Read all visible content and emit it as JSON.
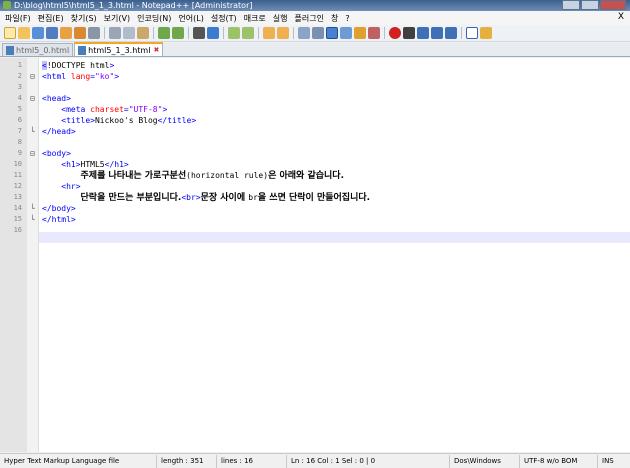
{
  "window": {
    "title": "D:\\blog\\html5\\html5_1_3.html - Notepad++ [Administrator]"
  },
  "menu": [
    "파일(F)",
    "편집(E)",
    "찾기(S)",
    "보기(V)",
    "인코딩(N)",
    "언어(L)",
    "설정(T)",
    "매크로",
    "실행",
    "플러그인",
    "창",
    "?"
  ],
  "menu_close": "X",
  "tabs": [
    {
      "label": "html5_0.html"
    },
    {
      "label": "html5_1_3.html"
    }
  ],
  "lines": [
    {
      "n": "1",
      "parts": [
        [
          "tag",
          "<"
        ],
        [
          "txt",
          "!DOCTYPE html"
        ],
        [
          "tag",
          ">"
        ]
      ]
    },
    {
      "n": "2",
      "parts": [
        [
          "tag",
          "<html "
        ],
        [
          "attr",
          "lang"
        ],
        [
          "tag",
          "="
        ],
        [
          "val",
          "\"ko\""
        ],
        [
          "tag",
          ">"
        ]
      ]
    },
    {
      "n": "3",
      "parts": []
    },
    {
      "n": "4",
      "parts": [
        [
          "tag",
          "<head>"
        ]
      ]
    },
    {
      "n": "5",
      "parts": [
        [
          "txt",
          "    "
        ],
        [
          "tag",
          "<meta "
        ],
        [
          "attr",
          "charset"
        ],
        [
          "tag",
          "="
        ],
        [
          "val",
          "\"UTF-8\""
        ],
        [
          "tag",
          ">"
        ]
      ]
    },
    {
      "n": "6",
      "parts": [
        [
          "txt",
          "    "
        ],
        [
          "tag",
          "<title>"
        ],
        [
          "txt",
          "Nickoo's Blog"
        ],
        [
          "tag",
          "</title>"
        ]
      ]
    },
    {
      "n": "7",
      "parts": [
        [
          "tag",
          "</head>"
        ]
      ]
    },
    {
      "n": "8",
      "parts": []
    },
    {
      "n": "9",
      "parts": [
        [
          "tag",
          "<body>"
        ]
      ]
    },
    {
      "n": "10",
      "parts": [
        [
          "txt",
          "    "
        ],
        [
          "tag",
          "<h1>"
        ],
        [
          "txt",
          "HTML5"
        ],
        [
          "tag",
          "</h1>"
        ]
      ]
    },
    {
      "n": "11",
      "parts": [
        [
          "txt",
          "        "
        ],
        [
          "kor",
          "주제를 나타내는 가로구분선"
        ],
        [
          "txt",
          "(horizontal rule)"
        ],
        [
          "kor",
          "은 아래와 같습니다."
        ]
      ]
    },
    {
      "n": "12",
      "parts": [
        [
          "txt",
          "    "
        ],
        [
          "tag",
          "<hr>"
        ]
      ]
    },
    {
      "n": "13",
      "parts": [
        [
          "txt",
          "        "
        ],
        [
          "kor",
          "단락을 만드는 부분입니다."
        ],
        [
          "tag",
          "<br>"
        ],
        [
          "kor",
          "문장 사이에 "
        ],
        [
          "txt",
          "br"
        ],
        [
          "kor",
          "을 쓰면 단락이 만들어집니다."
        ]
      ]
    },
    {
      "n": "14",
      "parts": [
        [
          "tag",
          "</body>"
        ]
      ]
    },
    {
      "n": "15",
      "parts": [
        [
          "tag",
          "</html>"
        ]
      ]
    },
    {
      "n": "16",
      "parts": []
    }
  ],
  "status": {
    "filetype": "Hyper Text Markup Language file",
    "length": "length : 351",
    "lines": "lines : 16",
    "position": "Ln : 16    Col : 1    Sel : 0 | 0",
    "eol": "Dos\\Windows",
    "encoding": "UTF-8 w/o BOM",
    "mode": "INS"
  },
  "colors": {
    "tag": "#0000ff",
    "attr": "#ff0000",
    "value": "#8000ff",
    "current_line": "#e8e8ff"
  }
}
